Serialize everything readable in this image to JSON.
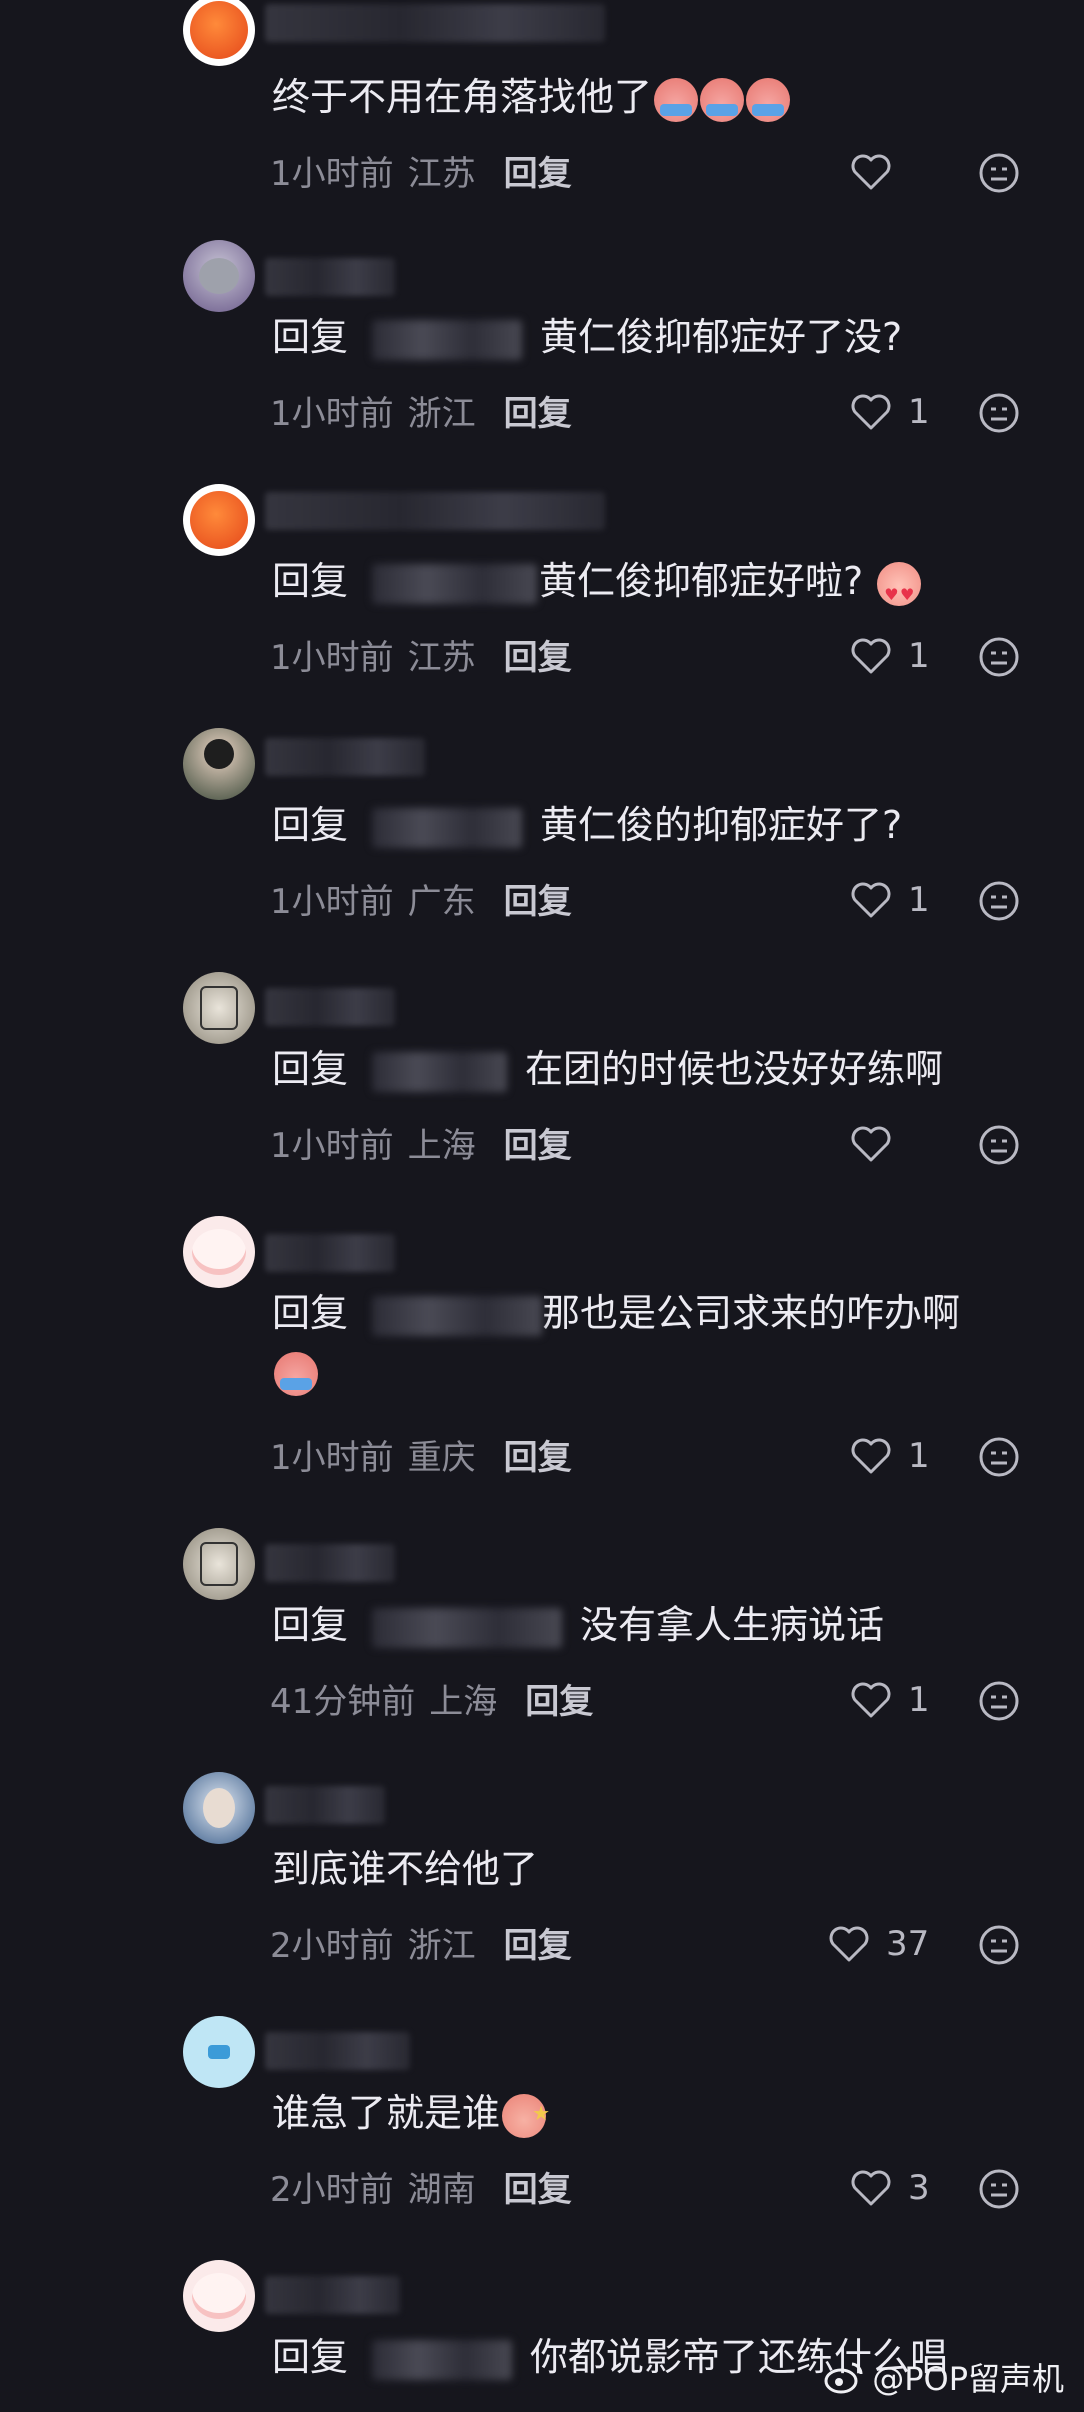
{
  "ui": {
    "reply_label": "回复",
    "reply_prefix": "回复"
  },
  "colors": {
    "background": "#16161d",
    "text": "#ecebf2",
    "meta": "#8c8c97"
  },
  "comments": [
    {
      "text": "终于不用在角落找他了",
      "time": "1小时前",
      "location": "江苏",
      "likes": ""
    },
    {
      "text": "黄仁俊抑郁症好了没?",
      "time": "1小时前",
      "location": "浙江",
      "likes": "1"
    },
    {
      "text": "黄仁俊抑郁症好啦?",
      "time": "1小时前",
      "location": "江苏",
      "likes": "1"
    },
    {
      "text": "黄仁俊的抑郁症好了?",
      "time": "1小时前",
      "location": "广东",
      "likes": "1"
    },
    {
      "text": "在团的时候也没好好练啊",
      "time": "1小时前",
      "location": "上海",
      "likes": ""
    },
    {
      "text": "那也是公司求来的咋办啊",
      "time": "1小时前",
      "location": "重庆",
      "likes": "1"
    },
    {
      "text": "没有拿人生病说话",
      "time": "41分钟前",
      "location": "上海",
      "likes": "1"
    },
    {
      "text": "到底谁不给他了",
      "time": "2小时前",
      "location": "浙江",
      "likes": "37"
    },
    {
      "text": "谁急了就是谁",
      "time": "2小时前",
      "location": "湖南",
      "likes": "3"
    },
    {
      "text": "你都说影帝了还练什么唱",
      "time": "",
      "location": "",
      "likes": ""
    }
  ],
  "watermark": "@POP留声机",
  "icons": {
    "like": "heart-outline-icon",
    "dislike": "meh-face-icon",
    "weibo": "weibo-logo-icon"
  }
}
